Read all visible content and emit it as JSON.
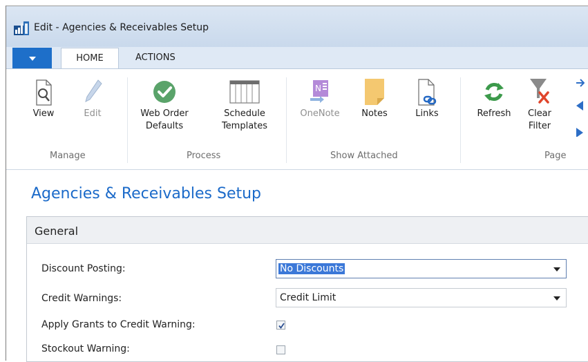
{
  "window": {
    "title": "Edit - Agencies & Receivables Setup"
  },
  "menu": {
    "app_button_icon": "triangle-down-icon"
  },
  "tabs": [
    {
      "label": "HOME",
      "active": true
    },
    {
      "label": "ACTIONS",
      "active": false
    }
  ],
  "ribbon": {
    "groups": [
      {
        "label": "Manage",
        "buttons": [
          {
            "line1": "View",
            "icon": "view-document-icon"
          },
          {
            "line1": "Edit",
            "icon": "pencil-icon",
            "disabled": true
          }
        ]
      },
      {
        "label": "Process",
        "buttons": [
          {
            "line1": "Web Order",
            "line2": "Defaults",
            "icon": "checkmark-circle-icon"
          },
          {
            "line1": "Schedule",
            "line2": "Templates",
            "icon": "table-columns-icon"
          }
        ]
      },
      {
        "label": "Show Attached",
        "buttons": [
          {
            "line1": "OneNote",
            "icon": "onenote-icon",
            "disabled": true
          },
          {
            "line1": "Notes",
            "icon": "sticky-note-icon"
          },
          {
            "line1": "Links",
            "icon": "link-document-icon"
          }
        ]
      },
      {
        "label": "Page",
        "buttons": [
          {
            "line1": "Refresh",
            "icon": "refresh-icon"
          },
          {
            "line1": "Clear",
            "line2": "Filter",
            "icon": "clear-filter-icon"
          }
        ]
      }
    ]
  },
  "page": {
    "title": "Agencies & Receivables Setup"
  },
  "fasttab": {
    "title": "General"
  },
  "fields": {
    "discount_posting": {
      "label": "Discount Posting:",
      "value": "No Discounts"
    },
    "credit_warnings": {
      "label": "Credit Warnings:",
      "value": "Credit Limit"
    },
    "apply_grants": {
      "label": "Apply Grants to Credit Warning:",
      "checked": true
    },
    "stockout_warning": {
      "label": "Stockout Warning:",
      "checked": false
    }
  },
  "colors": {
    "accent": "#1e6fc9",
    "title_blue": "#1b6ac9",
    "ok_green": "#5aa36a"
  }
}
